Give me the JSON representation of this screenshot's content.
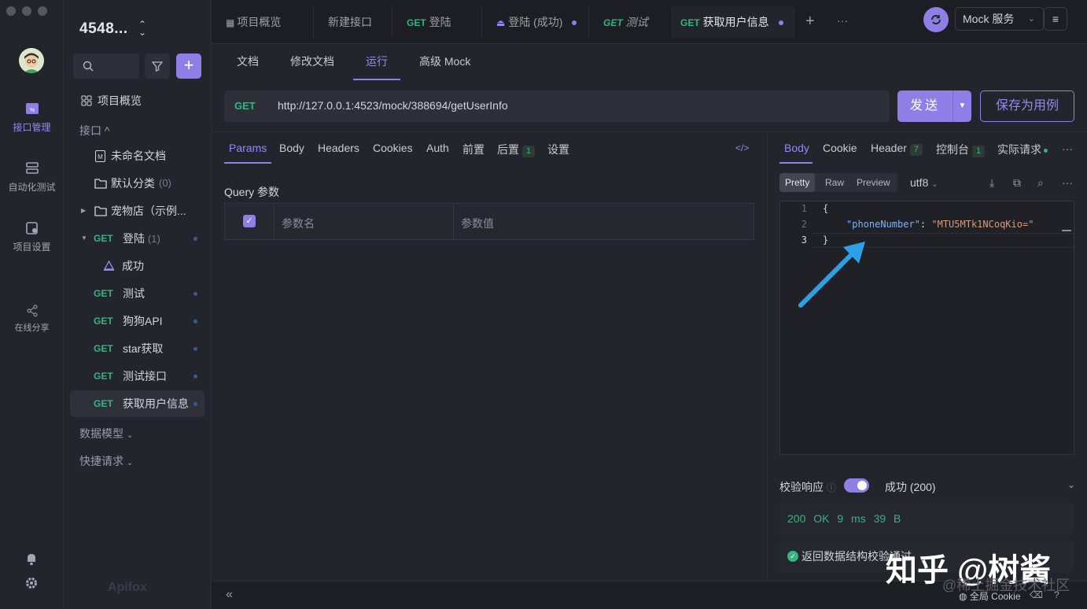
{
  "rail": {
    "items": [
      {
        "label": "接口管理",
        "icon": "api-management-icon"
      },
      {
        "label": "自动化测试",
        "icon": "automation-icon"
      },
      {
        "label": "项目设置",
        "icon": "settings-doc-icon"
      },
      {
        "label": "在线分享",
        "icon": "share-icon"
      }
    ]
  },
  "sidebar": {
    "project_title": "4548...",
    "overview": "项目概览",
    "section_api": "接口 ^",
    "unnamed_doc": "未命名文档",
    "default_folder": "默认分类",
    "default_count": "(0)",
    "pet_folder": "宠物店（示例...",
    "login": {
      "method": "GET",
      "label": "登陆",
      "count": "(1)"
    },
    "login_success": "成功",
    "endpoints": [
      {
        "method": "GET",
        "label": "测试"
      },
      {
        "method": "GET",
        "label": "狗狗API"
      },
      {
        "method": "GET",
        "label": "star获取"
      },
      {
        "method": "GET",
        "label": "测试接口"
      },
      {
        "method": "GET",
        "label": "获取用户信息"
      }
    ],
    "section_models": "数据模型",
    "section_quick": "快捷请求",
    "logo": "Apifox"
  },
  "tabs": [
    {
      "method": "",
      "label": "项目概览"
    },
    {
      "method": "",
      "label": "新建接口"
    },
    {
      "method": "GET",
      "label": "登陆"
    },
    {
      "method": "",
      "label": "登陆 (成功)"
    },
    {
      "method": "GET",
      "label": "测试"
    },
    {
      "method": "GET",
      "label": "获取用户信息"
    }
  ],
  "topbar": {
    "mock_service": "Mock 服务"
  },
  "subtabs": [
    "文档",
    "修改文档",
    "运行",
    "高级 Mock"
  ],
  "request": {
    "method": "GET",
    "url": "http://127.0.0.1:4523/mock/388694/getUserInfo",
    "send": "发送",
    "save_case": "保存为用例"
  },
  "param_tabs": [
    "Params",
    "Body",
    "Headers",
    "Cookies",
    "Auth",
    "前置",
    "后置",
    "设置"
  ],
  "param_badge": "1",
  "query": {
    "title": "Query 参数",
    "col_name": "参数名",
    "col_value": "参数值"
  },
  "response": {
    "tabs": [
      "Body",
      "Cookie",
      "Header",
      "控制台",
      "实际请求"
    ],
    "header_count": "7",
    "console_count": "1",
    "formats": [
      "Pretty",
      "Raw",
      "Preview"
    ],
    "encoding": "utf8",
    "lines": [
      "1",
      "2",
      "3"
    ],
    "code_open": "{",
    "code_key": "\"phoneNumber\"",
    "code_colon": ": ",
    "code_value": "\"MTU5MTk1NCoqKio=\"",
    "code_close": "}",
    "verify_label": "校验响应",
    "verify_status": "成功 (200)",
    "stats": "200 OK  9 ms  39 B",
    "check_text": "返回数据结构校验通过"
  },
  "bottom": {
    "global_cookie": "全局 Cookie"
  },
  "watermark": {
    "main": "知乎 @树酱",
    "sub": "@稀土掘金技术社区"
  },
  "colors": {
    "accent": "#8f7ee6",
    "get": "#36b37e",
    "bg": "#23252c"
  }
}
